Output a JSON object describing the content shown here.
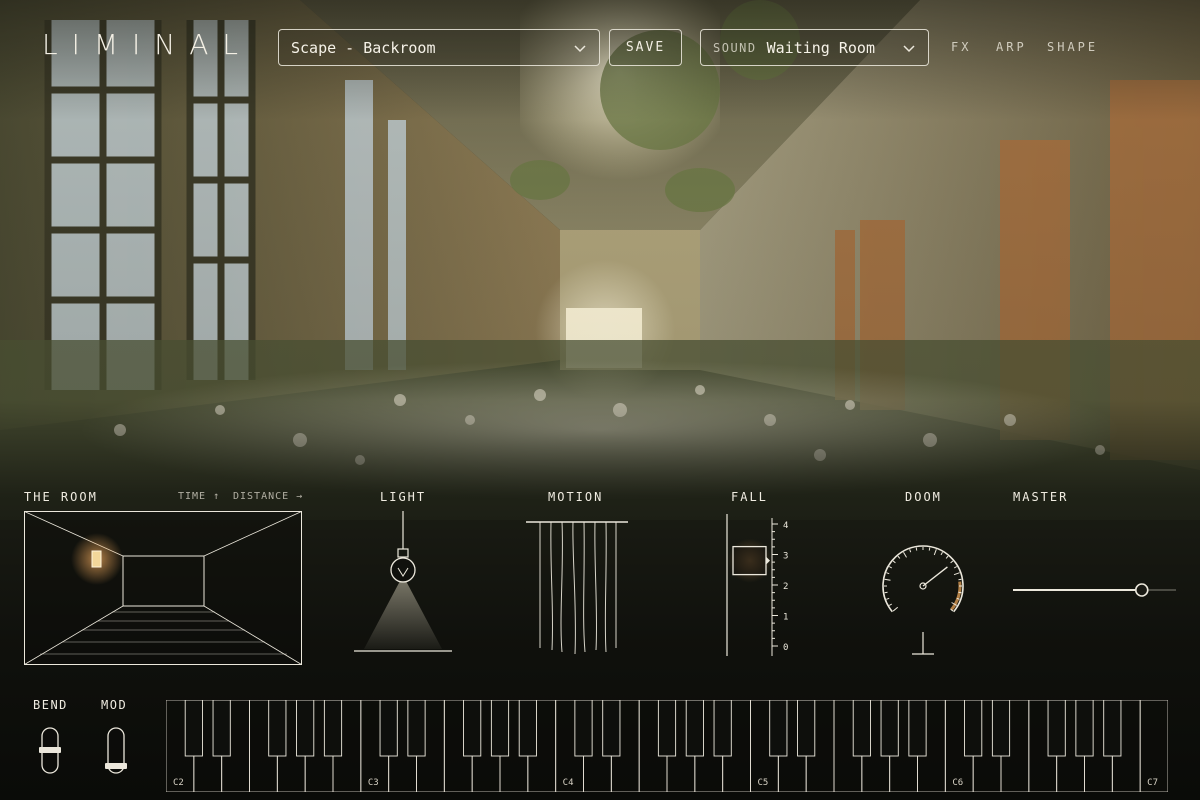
{
  "app": {
    "logo": "LIMINAL"
  },
  "header": {
    "preset": {
      "value": "Scape - Backroom"
    },
    "save_label": "SAVE",
    "sound": {
      "label": "SOUND",
      "value": "Waiting Room"
    },
    "nav": [
      "FX",
      "ARP",
      "SHAPE"
    ]
  },
  "controls": {
    "room": {
      "title": "THE ROOM",
      "hint_time": "TIME ↑",
      "hint_distance": "DISTANCE →"
    },
    "light": {
      "title": "LIGHT"
    },
    "motion": {
      "title": "MOTION"
    },
    "fall": {
      "title": "FALL",
      "scale": [
        "4",
        "3",
        "2",
        "1",
        "0"
      ],
      "value": 2.8
    },
    "doom": {
      "title": "DOOM",
      "value": 0.7
    },
    "master": {
      "title": "MASTER",
      "value": 0.79
    }
  },
  "keyboard": {
    "bend_label": "BEND",
    "mod_label": "MOD",
    "octave_labels": [
      "C2",
      "C3",
      "C4",
      "C5",
      "C6",
      "C7"
    ]
  },
  "colors": {
    "accent_glow": "#e8a45a",
    "line": "#ece8dc"
  }
}
